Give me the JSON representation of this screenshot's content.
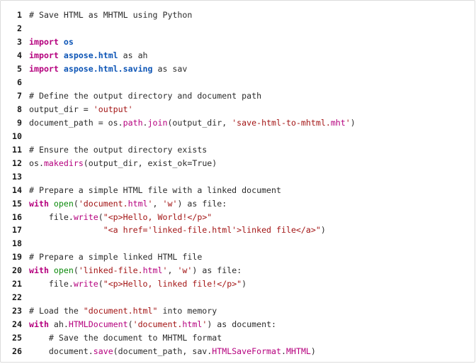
{
  "code": {
    "lines": [
      {
        "n": "1",
        "segs": [
          [
            "cm",
            "# Save HTML as MHTML using Python"
          ]
        ]
      },
      {
        "n": "2",
        "segs": []
      },
      {
        "n": "3",
        "segs": [
          [
            "kw",
            "import"
          ],
          [
            "plain",
            " "
          ],
          [
            "mod",
            "os"
          ]
        ]
      },
      {
        "n": "4",
        "segs": [
          [
            "kw",
            "import"
          ],
          [
            "plain",
            " "
          ],
          [
            "mod",
            "aspose.html"
          ],
          [
            "plain",
            " as ah"
          ]
        ]
      },
      {
        "n": "5",
        "segs": [
          [
            "kw",
            "import"
          ],
          [
            "plain",
            " "
          ],
          [
            "mod",
            "aspose.html.saving"
          ],
          [
            "plain",
            " as sav"
          ]
        ]
      },
      {
        "n": "6",
        "segs": []
      },
      {
        "n": "7",
        "segs": [
          [
            "cm",
            "# Define the output directory and document path"
          ]
        ]
      },
      {
        "n": "8",
        "segs": [
          [
            "plain",
            "output_dir = "
          ],
          [
            "str",
            "'output'"
          ]
        ]
      },
      {
        "n": "9",
        "segs": [
          [
            "plain",
            "document_path = os."
          ],
          [
            "attr",
            "path"
          ],
          [
            "plain",
            "."
          ],
          [
            "attr",
            "join"
          ],
          [
            "plain",
            "(output_dir, "
          ],
          [
            "str",
            "'save-html-to-mhtml."
          ],
          [
            "attr",
            "mht"
          ],
          [
            "str",
            "'"
          ],
          [
            "plain",
            ")"
          ]
        ]
      },
      {
        "n": "10",
        "segs": []
      },
      {
        "n": "11",
        "segs": [
          [
            "cm",
            "# Ensure the output directory exists"
          ]
        ]
      },
      {
        "n": "12",
        "segs": [
          [
            "plain",
            "os."
          ],
          [
            "attr",
            "makedirs"
          ],
          [
            "plain",
            "(output_dir, exist_ok=True)"
          ]
        ]
      },
      {
        "n": "13",
        "segs": []
      },
      {
        "n": "14",
        "segs": [
          [
            "cm",
            "# Prepare a simple HTML file with a linked document"
          ]
        ]
      },
      {
        "n": "15",
        "segs": [
          [
            "kw",
            "with"
          ],
          [
            "plain",
            " "
          ],
          [
            "fn",
            "open"
          ],
          [
            "plain",
            "("
          ],
          [
            "str",
            "'document."
          ],
          [
            "attr",
            "html"
          ],
          [
            "str",
            "'"
          ],
          [
            "plain",
            ", "
          ],
          [
            "str",
            "'w'"
          ],
          [
            "plain",
            ") as file:"
          ]
        ]
      },
      {
        "n": "16",
        "segs": [
          [
            "plain",
            "    file."
          ],
          [
            "attr",
            "write"
          ],
          [
            "plain",
            "("
          ],
          [
            "str",
            "\"<p>Hello, World!</p>\""
          ]
        ]
      },
      {
        "n": "17",
        "segs": [
          [
            "plain",
            "               "
          ],
          [
            "str",
            "\"<a href='linked-file.html'>linked file</a>\""
          ],
          [
            "plain",
            ")"
          ]
        ]
      },
      {
        "n": "18",
        "segs": []
      },
      {
        "n": "19",
        "segs": [
          [
            "cm",
            "# Prepare a simple linked HTML file"
          ]
        ]
      },
      {
        "n": "20",
        "segs": [
          [
            "kw",
            "with"
          ],
          [
            "plain",
            " "
          ],
          [
            "fn",
            "open"
          ],
          [
            "plain",
            "("
          ],
          [
            "str",
            "'linked-file."
          ],
          [
            "attr",
            "html"
          ],
          [
            "str",
            "'"
          ],
          [
            "plain",
            ", "
          ],
          [
            "str",
            "'w'"
          ],
          [
            "plain",
            ") as file:"
          ]
        ]
      },
      {
        "n": "21",
        "segs": [
          [
            "plain",
            "    file."
          ],
          [
            "attr",
            "write"
          ],
          [
            "plain",
            "("
          ],
          [
            "str",
            "\"<p>Hello, linked file!</p>\""
          ],
          [
            "plain",
            ")"
          ]
        ]
      },
      {
        "n": "22",
        "segs": []
      },
      {
        "n": "23",
        "segs": [
          [
            "cm",
            "# Load the "
          ],
          [
            "str",
            "\"document.html\""
          ],
          [
            "cm",
            " into memory"
          ]
        ]
      },
      {
        "n": "24",
        "segs": [
          [
            "kw",
            "with"
          ],
          [
            "plain",
            " ah."
          ],
          [
            "attr",
            "HTMLDocument"
          ],
          [
            "plain",
            "("
          ],
          [
            "str",
            "'document."
          ],
          [
            "attr",
            "html"
          ],
          [
            "str",
            "'"
          ],
          [
            "plain",
            ") as document:"
          ]
        ]
      },
      {
        "n": "25",
        "segs": [
          [
            "cm",
            "    # Save the document to MHTML format"
          ]
        ]
      },
      {
        "n": "26",
        "segs": [
          [
            "plain",
            "    document."
          ],
          [
            "attr",
            "save"
          ],
          [
            "plain",
            "(document_path, sav."
          ],
          [
            "attr",
            "HTMLSaveFormat"
          ],
          [
            "plain",
            "."
          ],
          [
            "attr",
            "MHTML"
          ],
          [
            "plain",
            ")"
          ]
        ]
      }
    ]
  }
}
